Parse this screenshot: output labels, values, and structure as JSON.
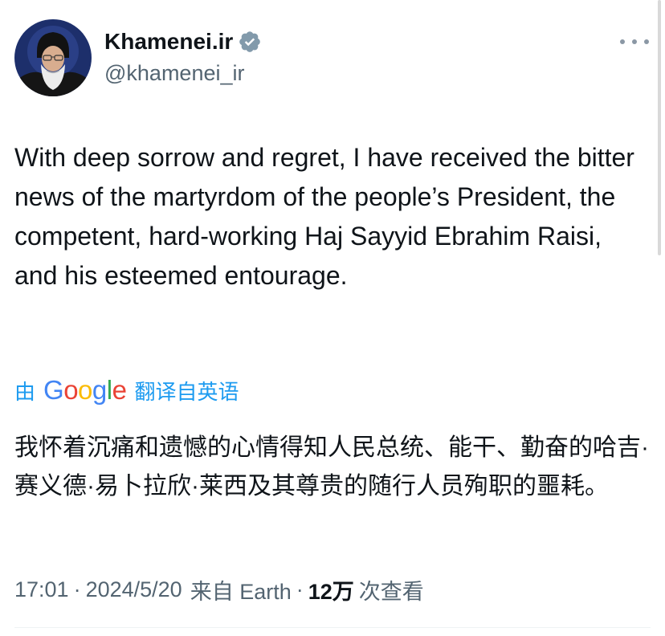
{
  "author": {
    "display_name": "Khamenei.ir",
    "handle": "@khamenei_ir",
    "verified": true,
    "avatar_icon": "profile-photo",
    "verified_color": "#829aab"
  },
  "tweet": {
    "text": "With deep sorrow and regret, I have received the bitter news of the martyrdom of the people’s President, the competent, hard-working Haj Sayyid Ebrahim Raisi, and his esteemed entourage."
  },
  "translation": {
    "prefix": "由",
    "provider": "Google",
    "suffix": "翻译自英语",
    "text": "我怀着沉痛和遗憾的心情得知人民总统、能干、勤奋的哈吉·赛义德·易卜拉欣·莱西及其尊贵的随行人员殉职的噩耗。"
  },
  "meta": {
    "time": "17:01",
    "separator": "·",
    "date": "2024/5/20",
    "source": "来自 Earth",
    "views_count": "12万",
    "views_label": "次查看"
  },
  "colors": {
    "text_primary": "#0f1419",
    "text_secondary": "#536471",
    "link": "#1d9bf0"
  }
}
